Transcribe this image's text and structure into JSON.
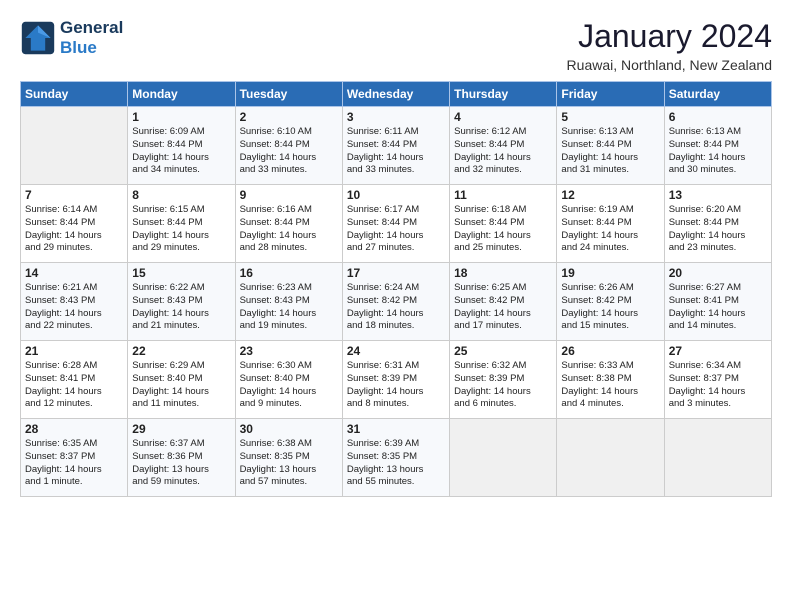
{
  "logo": {
    "line1": "General",
    "line2": "Blue"
  },
  "title": "January 2024",
  "subtitle": "Ruawai, Northland, New Zealand",
  "days_header": [
    "Sunday",
    "Monday",
    "Tuesday",
    "Wednesday",
    "Thursday",
    "Friday",
    "Saturday"
  ],
  "weeks": [
    [
      {
        "day": "",
        "info": ""
      },
      {
        "day": "1",
        "info": "Sunrise: 6:09 AM\nSunset: 8:44 PM\nDaylight: 14 hours\nand 34 minutes."
      },
      {
        "day": "2",
        "info": "Sunrise: 6:10 AM\nSunset: 8:44 PM\nDaylight: 14 hours\nand 33 minutes."
      },
      {
        "day": "3",
        "info": "Sunrise: 6:11 AM\nSunset: 8:44 PM\nDaylight: 14 hours\nand 33 minutes."
      },
      {
        "day": "4",
        "info": "Sunrise: 6:12 AM\nSunset: 8:44 PM\nDaylight: 14 hours\nand 32 minutes."
      },
      {
        "day": "5",
        "info": "Sunrise: 6:13 AM\nSunset: 8:44 PM\nDaylight: 14 hours\nand 31 minutes."
      },
      {
        "day": "6",
        "info": "Sunrise: 6:13 AM\nSunset: 8:44 PM\nDaylight: 14 hours\nand 30 minutes."
      }
    ],
    [
      {
        "day": "7",
        "info": "Sunrise: 6:14 AM\nSunset: 8:44 PM\nDaylight: 14 hours\nand 29 minutes."
      },
      {
        "day": "8",
        "info": "Sunrise: 6:15 AM\nSunset: 8:44 PM\nDaylight: 14 hours\nand 29 minutes."
      },
      {
        "day": "9",
        "info": "Sunrise: 6:16 AM\nSunset: 8:44 PM\nDaylight: 14 hours\nand 28 minutes."
      },
      {
        "day": "10",
        "info": "Sunrise: 6:17 AM\nSunset: 8:44 PM\nDaylight: 14 hours\nand 27 minutes."
      },
      {
        "day": "11",
        "info": "Sunrise: 6:18 AM\nSunset: 8:44 PM\nDaylight: 14 hours\nand 25 minutes."
      },
      {
        "day": "12",
        "info": "Sunrise: 6:19 AM\nSunset: 8:44 PM\nDaylight: 14 hours\nand 24 minutes."
      },
      {
        "day": "13",
        "info": "Sunrise: 6:20 AM\nSunset: 8:44 PM\nDaylight: 14 hours\nand 23 minutes."
      }
    ],
    [
      {
        "day": "14",
        "info": "Sunrise: 6:21 AM\nSunset: 8:43 PM\nDaylight: 14 hours\nand 22 minutes."
      },
      {
        "day": "15",
        "info": "Sunrise: 6:22 AM\nSunset: 8:43 PM\nDaylight: 14 hours\nand 21 minutes."
      },
      {
        "day": "16",
        "info": "Sunrise: 6:23 AM\nSunset: 8:43 PM\nDaylight: 14 hours\nand 19 minutes."
      },
      {
        "day": "17",
        "info": "Sunrise: 6:24 AM\nSunset: 8:42 PM\nDaylight: 14 hours\nand 18 minutes."
      },
      {
        "day": "18",
        "info": "Sunrise: 6:25 AM\nSunset: 8:42 PM\nDaylight: 14 hours\nand 17 minutes."
      },
      {
        "day": "19",
        "info": "Sunrise: 6:26 AM\nSunset: 8:42 PM\nDaylight: 14 hours\nand 15 minutes."
      },
      {
        "day": "20",
        "info": "Sunrise: 6:27 AM\nSunset: 8:41 PM\nDaylight: 14 hours\nand 14 minutes."
      }
    ],
    [
      {
        "day": "21",
        "info": "Sunrise: 6:28 AM\nSunset: 8:41 PM\nDaylight: 14 hours\nand 12 minutes."
      },
      {
        "day": "22",
        "info": "Sunrise: 6:29 AM\nSunset: 8:40 PM\nDaylight: 14 hours\nand 11 minutes."
      },
      {
        "day": "23",
        "info": "Sunrise: 6:30 AM\nSunset: 8:40 PM\nDaylight: 14 hours\nand 9 minutes."
      },
      {
        "day": "24",
        "info": "Sunrise: 6:31 AM\nSunset: 8:39 PM\nDaylight: 14 hours\nand 8 minutes."
      },
      {
        "day": "25",
        "info": "Sunrise: 6:32 AM\nSunset: 8:39 PM\nDaylight: 14 hours\nand 6 minutes."
      },
      {
        "day": "26",
        "info": "Sunrise: 6:33 AM\nSunset: 8:38 PM\nDaylight: 14 hours\nand 4 minutes."
      },
      {
        "day": "27",
        "info": "Sunrise: 6:34 AM\nSunset: 8:37 PM\nDaylight: 14 hours\nand 3 minutes."
      }
    ],
    [
      {
        "day": "28",
        "info": "Sunrise: 6:35 AM\nSunset: 8:37 PM\nDaylight: 14 hours\nand 1 minute."
      },
      {
        "day": "29",
        "info": "Sunrise: 6:37 AM\nSunset: 8:36 PM\nDaylight: 13 hours\nand 59 minutes."
      },
      {
        "day": "30",
        "info": "Sunrise: 6:38 AM\nSunset: 8:35 PM\nDaylight: 13 hours\nand 57 minutes."
      },
      {
        "day": "31",
        "info": "Sunrise: 6:39 AM\nSunset: 8:35 PM\nDaylight: 13 hours\nand 55 minutes."
      },
      {
        "day": "",
        "info": ""
      },
      {
        "day": "",
        "info": ""
      },
      {
        "day": "",
        "info": ""
      }
    ]
  ]
}
